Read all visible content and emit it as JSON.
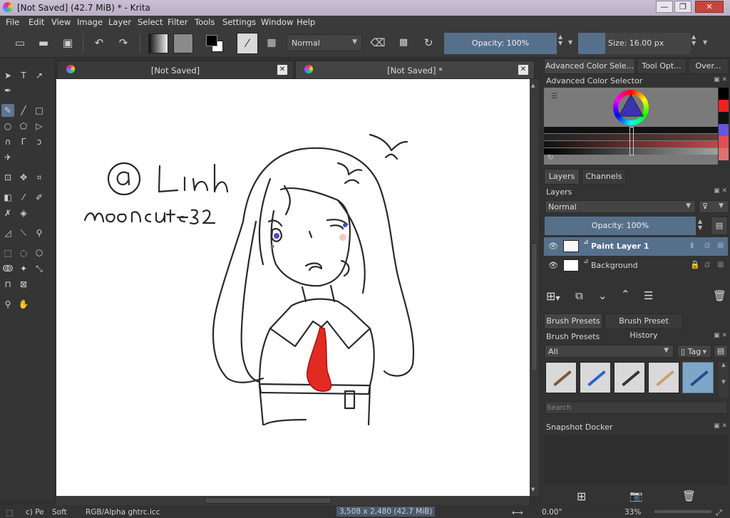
{
  "window": {
    "title": "[Not Saved]  (42.7 MiB)  * - Krita",
    "controls": [
      "—",
      "❐",
      "✕"
    ]
  },
  "menu": [
    "File",
    "Edit",
    "View",
    "Image",
    "Layer",
    "Select",
    "Filter",
    "Tools",
    "Settings",
    "Window",
    "Help"
  ],
  "toolbar": {
    "blend_mode": "Normal",
    "opacity": "Opacity: 100%",
    "size": "Size: 16.00 px"
  },
  "tabs": [
    {
      "label": "[Not Saved]"
    },
    {
      "label": "[Not Saved]  *"
    }
  ],
  "canvas": {
    "signature_line1": "@ Linh",
    "signature_line2": "mooncute32"
  },
  "dock": {
    "top_tabs": [
      "Advanced Color Sele...",
      "Tool Opt...",
      "Over..."
    ],
    "color_selector_title": "Advanced Color Selector",
    "layers_tabs": [
      "Layers",
      "Channels"
    ],
    "layers_title": "Layers",
    "layer_blend": "Normal",
    "layer_opacity": "Opacity:  100%",
    "layers": [
      {
        "name": "Paint Layer 1",
        "selected": true
      },
      {
        "name": "Background",
        "selected": false
      }
    ],
    "brush_tabs": [
      "Brush Presets",
      "Brush Preset History"
    ],
    "brush_title": "Brush Presets",
    "brush_filter": "All",
    "brush_tag": "Tag",
    "search_placeholder": "Search",
    "snapshot_title": "Snapshot Docker"
  },
  "status": {
    "brush": "c) Pe",
    "brush2": "Soft",
    "color_profile": "RGB/Alpha  ghtrc.icc",
    "image_size": "3,508 x 2,480 (42.7 MiB)",
    "rotation": "0.00°",
    "zoom": "33%"
  },
  "colors": {
    "accent": "#56708b",
    "tie_red": "#e32a22"
  }
}
